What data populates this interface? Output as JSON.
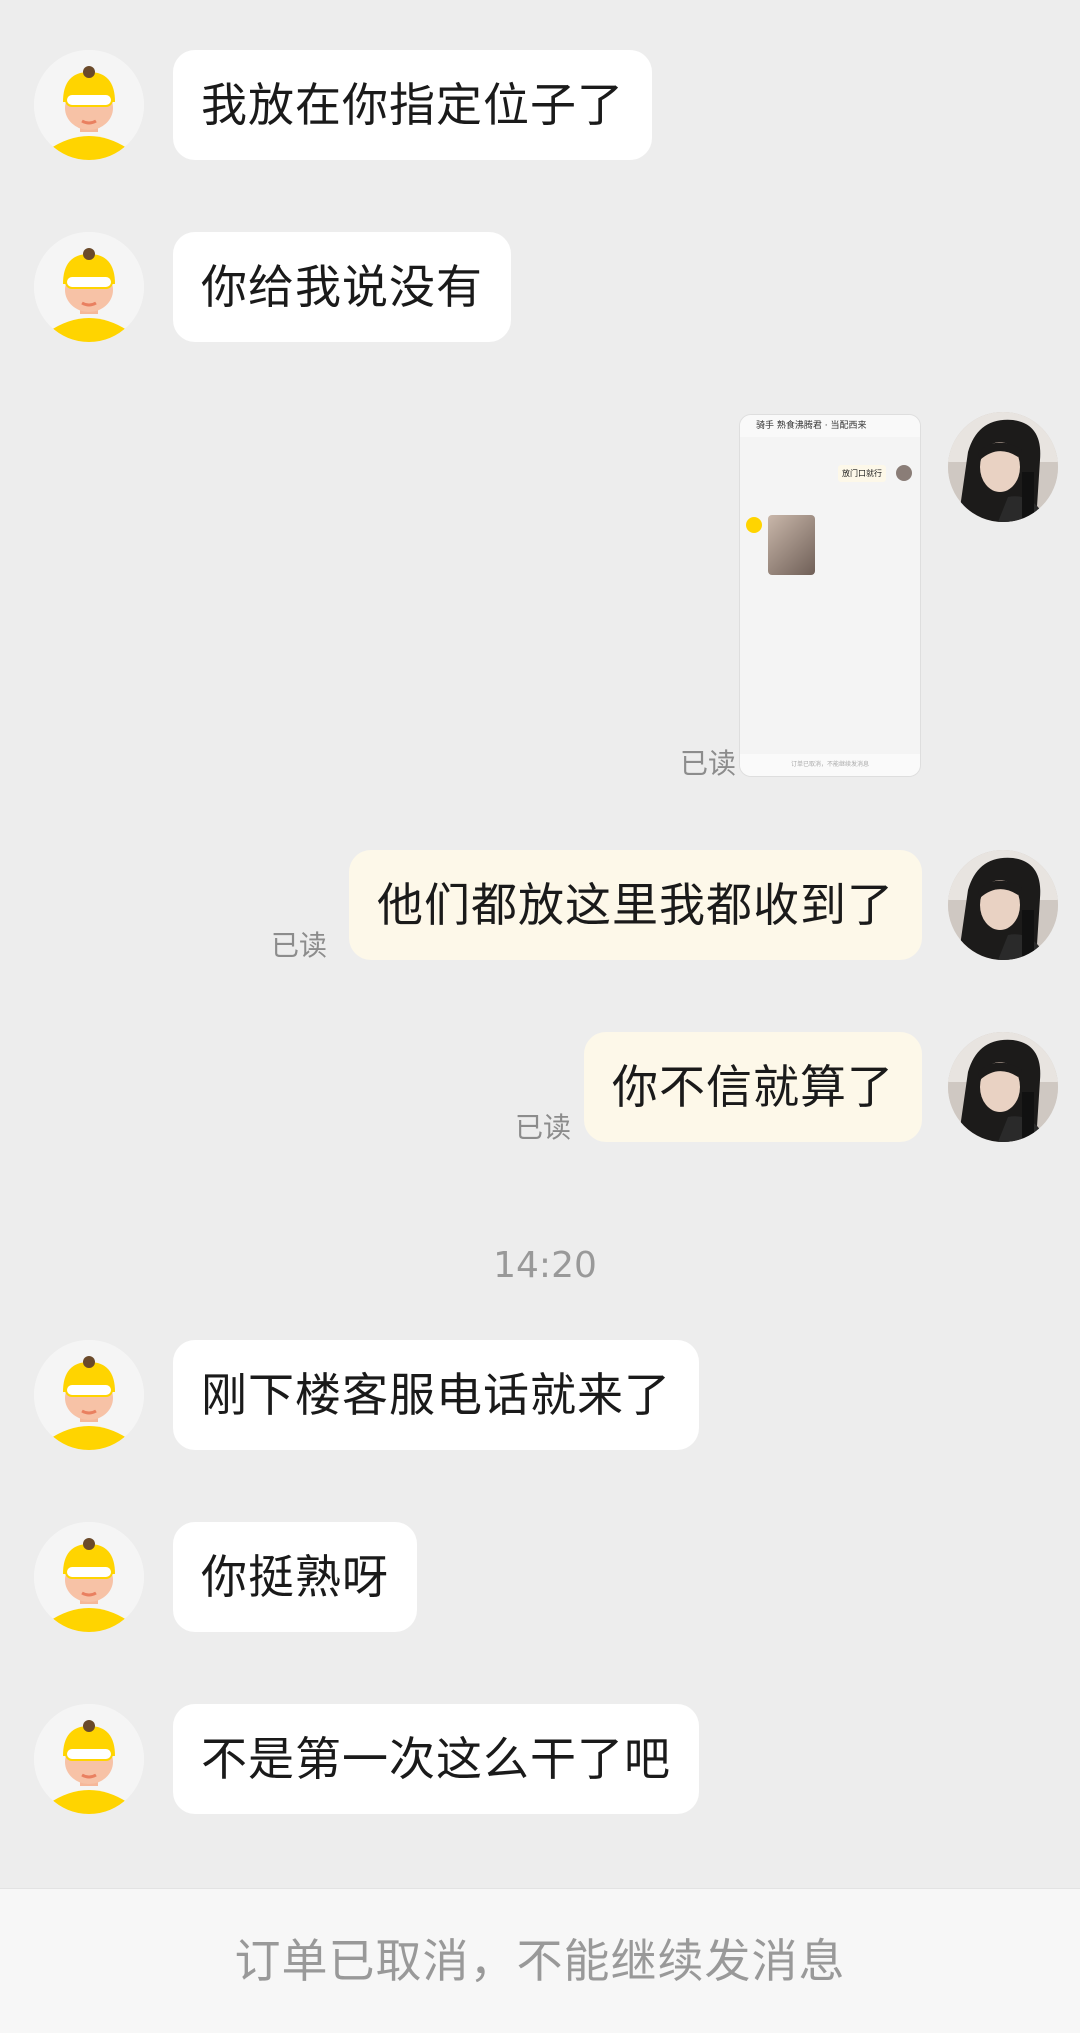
{
  "messages": [
    {
      "side": "in",
      "text": "我放在你指定位子了"
    },
    {
      "side": "in",
      "text": "你给我说没有"
    },
    {
      "side": "out",
      "type": "image",
      "read": "已读"
    },
    {
      "side": "out",
      "text": "他们都放这里我都收到了",
      "read": "已读"
    },
    {
      "side": "out",
      "text": "你不信就算了",
      "read": "已读"
    },
    {
      "side": "in",
      "text": "刚下楼客服电话就来了"
    },
    {
      "side": "in",
      "text": "你挺熟呀"
    },
    {
      "side": "in",
      "text": "不是第一次这么干了吧"
    }
  ],
  "timestamp": "14:20",
  "footer_text": "订单已取消，不能继续发消息",
  "thumbnail": {
    "header": "骑手 熟食沸腾君 · 当配西来",
    "bubble": "放门口就行",
    "footer": "订单已取消，不能继续发消息"
  },
  "colors": {
    "background": "#ededed",
    "incoming_bubble": "#ffffff",
    "outgoing_bubble": "#fdf8e9",
    "rider_yellow": "#ffd400"
  },
  "icons": {
    "rider_avatar": "rider-helmet-avatar-icon",
    "user_avatar": "user-photo-avatar"
  }
}
